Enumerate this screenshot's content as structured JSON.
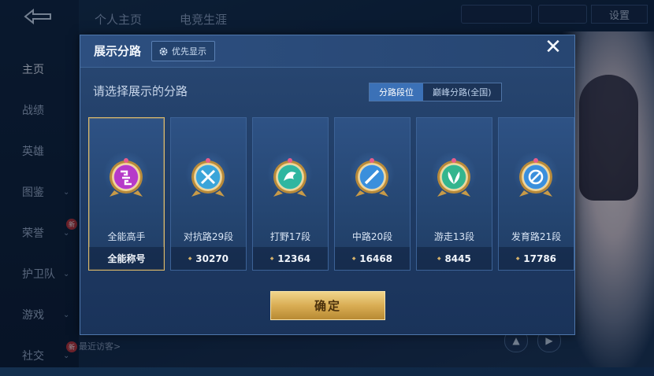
{
  "background": {
    "top_tabs": [
      "个人主页",
      "电竞生涯"
    ],
    "side_nav": [
      {
        "label": "主页",
        "active": true,
        "chevron": false,
        "new": false
      },
      {
        "label": "战绩",
        "active": false,
        "chevron": false,
        "new": false
      },
      {
        "label": "英雄",
        "active": false,
        "chevron": false,
        "new": false
      },
      {
        "label": "图鉴",
        "active": false,
        "chevron": true,
        "new": false
      },
      {
        "label": "荣誉",
        "active": false,
        "chevron": true,
        "new": true
      },
      {
        "label": "护卫队",
        "active": false,
        "chevron": true,
        "new": false
      },
      {
        "label": "游戏",
        "active": false,
        "chevron": true,
        "new": false
      },
      {
        "label": "社交",
        "active": false,
        "chevron": true,
        "new": true
      }
    ],
    "settings_label": "设置",
    "recent_visitors_label": "最近访客>",
    "new_badge": "新"
  },
  "dialog": {
    "title": "展示分路",
    "priority_button": "优先显示",
    "subtitle": "请选择展示的分路",
    "segments": [
      {
        "label": "分路段位",
        "active": true
      },
      {
        "label": "巅峰分路(全国)",
        "active": false
      }
    ],
    "cards": [
      {
        "name": "全能高手",
        "footer": "全能称号",
        "points": false,
        "selected": true,
        "icon": "all-round-icon",
        "color": "#b63ac9"
      },
      {
        "name": "对抗路29段",
        "footer": "30270",
        "points": true,
        "selected": false,
        "icon": "clash-lane-icon",
        "color": "#3aa4d9"
      },
      {
        "name": "打野17段",
        "footer": "12364",
        "points": true,
        "selected": false,
        "icon": "jungle-icon",
        "color": "#2fb6a0"
      },
      {
        "name": "中路20段",
        "footer": "16468",
        "points": true,
        "selected": false,
        "icon": "mid-lane-icon",
        "color": "#3a8fdc"
      },
      {
        "name": "游走13段",
        "footer": "8445",
        "points": true,
        "selected": false,
        "icon": "roam-icon",
        "color": "#34b58e"
      },
      {
        "name": "发育路21段",
        "footer": "17786",
        "points": true,
        "selected": false,
        "icon": "farm-lane-icon",
        "color": "#3a8fdc"
      }
    ],
    "confirm_label": "确定"
  },
  "colors": {
    "accent_gold": "#d9ad54",
    "segment_active": "#3b71b7"
  }
}
